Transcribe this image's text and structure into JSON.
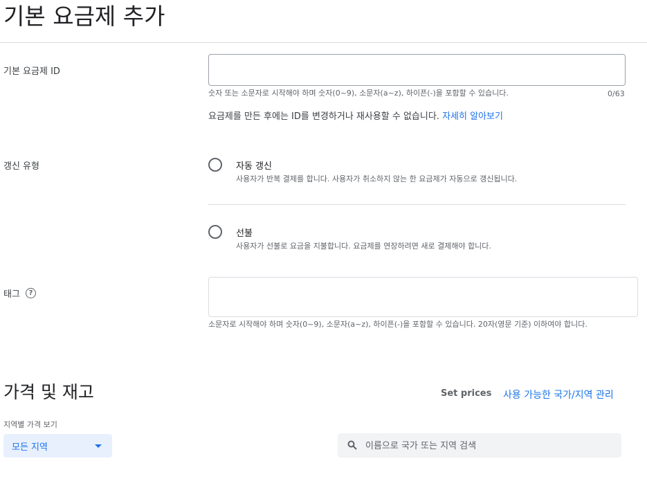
{
  "page": {
    "title": "기본 요금제 추가"
  },
  "plan_id": {
    "label": "기본 요금제 ID",
    "value": "",
    "helper": "숫자 또는 소문자로 시작해야 하며 숫자(0~9), 소문자(a~z), 하이픈(-)을 포함할 수 있습니다.",
    "counter": "0/63",
    "note": "요금제를 만든 후에는 ID를 변경하거나 재사용할 수 없습니다.",
    "learn_more": "자세히 알아보기"
  },
  "renewal": {
    "label": "갱신 유형",
    "options": [
      {
        "title": "자동 갱신",
        "desc": "사용자가 반복 결제를 합니다. 사용자가 취소하지 않는 한 요금제가 자동으로 갱신됩니다."
      },
      {
        "title": "선불",
        "desc": "사용자가 선불로 요금을 지불합니다. 요금제를 연장하려면 새로 결제해야 합니다."
      }
    ]
  },
  "tags": {
    "label": "태그",
    "help_icon": "help-icon",
    "value": "",
    "helper": "소문자로 시작해야 하며 숫자(0~9), 소문자(a~z), 하이픈(-)을 포함할 수 있습니다. 20자(영문 기준) 이하여야 합니다."
  },
  "pricing": {
    "title": "가격 및 재고",
    "set_prices": "Set prices",
    "manage_link": "사용 가능한 국가/지역 관리",
    "region_label": "지역별 가격 보기",
    "region_value": "모든 지역",
    "search_placeholder": "이름으로 국가 또는 지역 검색",
    "search_icon": "search-icon"
  },
  "colors": {
    "accent": "#1a73e8",
    "text": "#202124",
    "muted": "#5f6368",
    "border": "#dadce0"
  }
}
